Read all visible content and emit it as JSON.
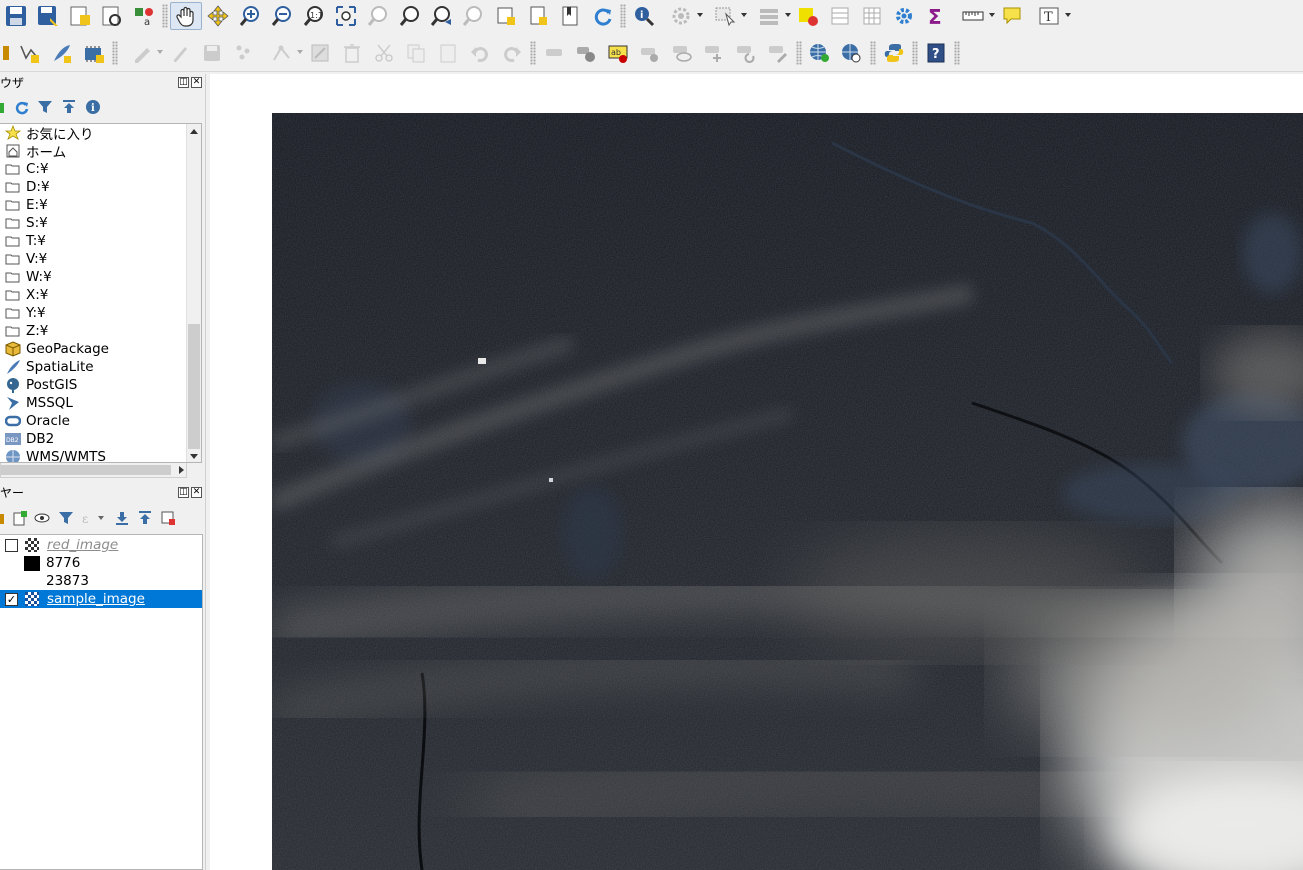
{
  "browser_panel": {
    "title": "ウザ",
    "items": [
      {
        "label": "お気に入り",
        "icon": "star-icon"
      },
      {
        "label": "ホーム",
        "icon": "home-icon"
      },
      {
        "label": "C:¥",
        "icon": "folder-icon"
      },
      {
        "label": "D:¥",
        "icon": "folder-icon"
      },
      {
        "label": "E:¥",
        "icon": "folder-icon"
      },
      {
        "label": "S:¥",
        "icon": "folder-icon"
      },
      {
        "label": "T:¥",
        "icon": "folder-icon"
      },
      {
        "label": "V:¥",
        "icon": "folder-icon"
      },
      {
        "label": "W:¥",
        "icon": "folder-icon"
      },
      {
        "label": "X:¥",
        "icon": "folder-icon"
      },
      {
        "label": "Y:¥",
        "icon": "folder-icon"
      },
      {
        "label": "Z:¥",
        "icon": "folder-icon"
      },
      {
        "label": "GeoPackage",
        "icon": "geopackage-icon"
      },
      {
        "label": "SpatiaLite",
        "icon": "spatialite-icon"
      },
      {
        "label": "PostGIS",
        "icon": "postgis-icon"
      },
      {
        "label": "MSSQL",
        "icon": "mssql-icon"
      },
      {
        "label": "Oracle",
        "icon": "oracle-icon"
      },
      {
        "label": "DB2",
        "icon": "db2-icon"
      },
      {
        "label": "WMS/WMTS",
        "icon": "wms-icon"
      }
    ],
    "db2_badge": "DB2"
  },
  "layers_panel": {
    "title": "ヤー",
    "layers": [
      {
        "name": "red_image",
        "checked": false,
        "legend": [
          {
            "label": "8776",
            "color": "#000000"
          },
          {
            "label": "23873"
          }
        ]
      },
      {
        "name": "sample_image",
        "checked": true
      }
    ],
    "checkmark": "✓"
  },
  "panel_buttons": {
    "float": "◫",
    "close": "✕"
  },
  "colors": {
    "selection": "#0078d7",
    "map_background": "#ffffff"
  }
}
